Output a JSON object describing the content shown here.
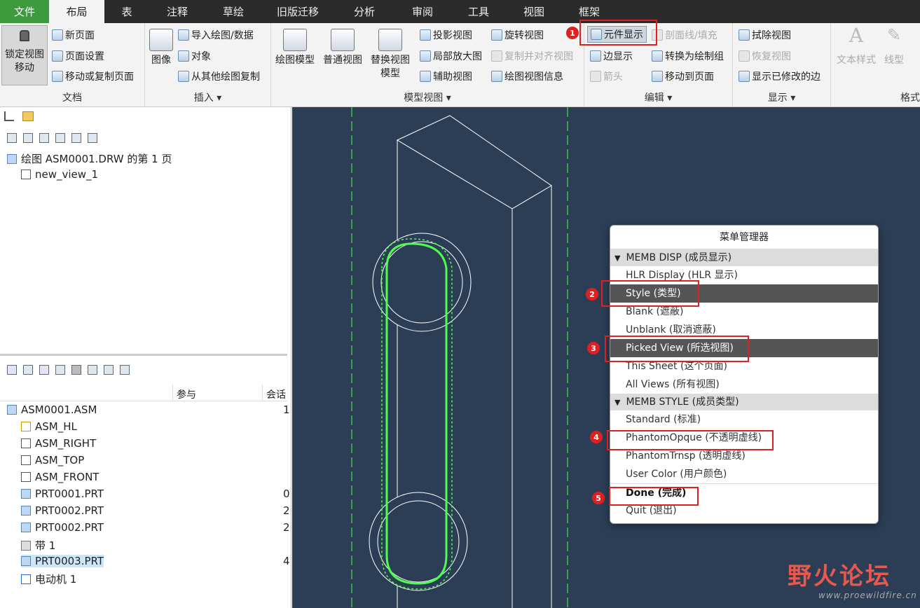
{
  "tabs": [
    "文件",
    "布局",
    "表",
    "注释",
    "草绘",
    "旧版迁移",
    "分析",
    "审阅",
    "工具",
    "视图",
    "框架"
  ],
  "ribbon": {
    "doc": {
      "lock_line1": "锁定视图",
      "lock_line2": "移动",
      "new_page": "新页面",
      "page_setup": "页面设置",
      "move_copy": "移动或复制页面",
      "label": "文档"
    },
    "insert": {
      "image": "图像",
      "import": "导入绘图/数据",
      "object": "对象",
      "copy_from": "从其他绘图复制",
      "label": "插入"
    },
    "model_view": {
      "drawing_model": "绘图模型",
      "general_view": "普通视图",
      "replace_line1": "替换视图",
      "replace_line2": "模型",
      "projection": "投影视图",
      "detail": "局部放大图",
      "auxiliary": "辅助视图",
      "rotate": "旋转视图",
      "copy_align": "复制并对齐视图",
      "view_info": "绘图视图信息",
      "label": "模型视图"
    },
    "edit": {
      "component_display": "元件显示",
      "section_hatch": "剖面线/填充",
      "edge_display": "边显示",
      "arrow": "箭头",
      "convert_group": "转换为绘制组",
      "move_to_page": "移动到页面",
      "label": "编辑"
    },
    "display": {
      "erase_view": "拭除视图",
      "restore_view": "恢复视图",
      "show_modified": "显示已修改的边",
      "label": "显示"
    },
    "format": {
      "text_style": "文本样式",
      "line_style": "线型",
      "label": "格式"
    }
  },
  "left": {
    "top_tree": [
      {
        "label": "绘图 ASM0001.DRW 的第 1 页"
      },
      {
        "label": "new_view_1"
      }
    ],
    "columns": {
      "participate": "参与",
      "session": "会话"
    },
    "model_tree": [
      {
        "label": "ASM0001.ASM",
        "value": "1",
        "icon": "assembly-icon"
      },
      {
        "label": "ASM_HL",
        "value": "",
        "icon": "csys-icon"
      },
      {
        "label": "ASM_RIGHT",
        "value": "",
        "icon": "plane-icon"
      },
      {
        "label": "ASM_TOP",
        "value": "",
        "icon": "plane-icon"
      },
      {
        "label": "ASM_FRONT",
        "value": "",
        "icon": "plane-icon"
      },
      {
        "label": "PRT0001.PRT",
        "value": "0",
        "icon": "part-icon"
      },
      {
        "label": "PRT0002.PRT",
        "value": "2",
        "icon": "part-icon"
      },
      {
        "label": "PRT0002.PRT",
        "value": "2",
        "icon": "part-icon"
      },
      {
        "label": "带 1",
        "value": "",
        "icon": "belt-icon"
      },
      {
        "label": "PRT0003.PRT",
        "value": "4",
        "icon": "part-icon"
      },
      {
        "label": "电动机 1",
        "value": "",
        "icon": "motor-icon"
      }
    ]
  },
  "menu": {
    "title": "菜单管理器",
    "sec1": "MEMB DISP (成员显示)",
    "sec1_items": [
      "HLR Display (HLR 显示)",
      "Style (类型)",
      "Blank (遮蔽)",
      "Unblank (取消遮蔽)",
      "Picked View (所选视图)",
      "This Sheet (这个页面)",
      "All Views (所有视图)"
    ],
    "sec2": "MEMB STYLE (成员类型)",
    "sec2_items": [
      "Standard (标准)",
      "PhantomOpque (不透明虚线)",
      "PhantomTrnsp (透明虚线)",
      "User Color (用户颜色)"
    ],
    "done": "Done (完成)",
    "quit": "Quit (退出)"
  },
  "badges": [
    "1",
    "2",
    "3",
    "4",
    "5"
  ],
  "watermark": {
    "main": "野火论坛",
    "url": "www.proewildfire.cn"
  },
  "colors": {
    "file_tab": "#3d9a3d",
    "canvas": "#2c3e55",
    "highlight": "#e02020",
    "belt": "#4dff4d"
  }
}
